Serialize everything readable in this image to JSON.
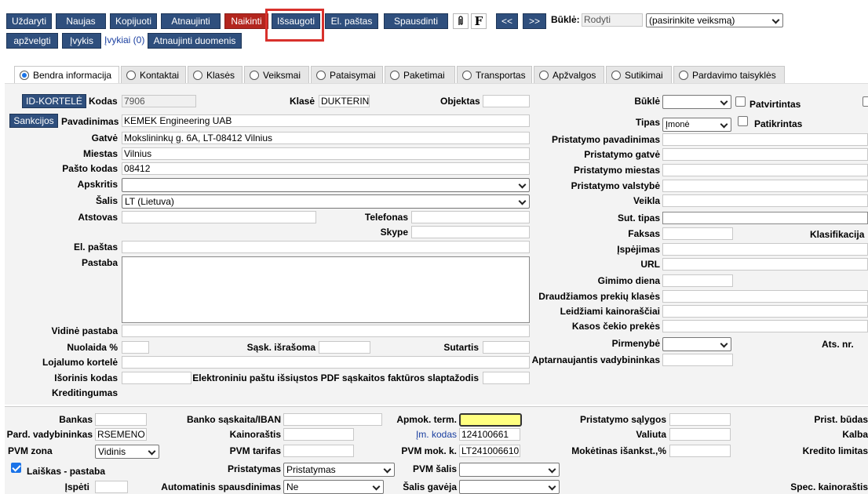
{
  "toolbar": {
    "close": "Uždaryti",
    "new": "Naujas",
    "copy": "Kopijuoti",
    "refresh": "Atnaujinti",
    "cancel": "Naikinti",
    "save": "Išsaugoti",
    "email": "El. paštas",
    "print": "Spausdinti",
    "f_icon": "F",
    "prev": "<<",
    "next": ">>",
    "status_label": "Būklė:",
    "status_value": "Rodyti",
    "action_select": "(pasirinkite veiksmą)",
    "overview": "apžvelgti",
    "events": "Įvykis",
    "events_count": "Įvykiai (0)",
    "refresh_data": "Atnaujinti duomenis"
  },
  "tabs": [
    {
      "label": "Bendra informacija",
      "active": true
    },
    {
      "label": "Kontaktai",
      "active": false
    },
    {
      "label": "Klasės",
      "active": false
    },
    {
      "label": "Veiksmai",
      "active": false
    },
    {
      "label": "Pataisymai",
      "active": false
    },
    {
      "label": "Paketimai",
      "active": false
    },
    {
      "label": "Transportas",
      "active": false
    },
    {
      "label": "Apžvalgos",
      "active": false
    },
    {
      "label": "Sutikimai",
      "active": false
    },
    {
      "label": "Pardavimo taisyklės",
      "active": false
    }
  ],
  "form": {
    "id_card_button": "ID-KORTELĖ",
    "code_label": "Kodas",
    "code_value": "7906",
    "class_label": "Klasė",
    "class_value": "DUKTERINI",
    "object_label": "Objektas",
    "state_label": "Būklė",
    "confirmed_label": "Patvirtintas",
    "sanctions_button": "Sankcijos",
    "name_label": "Pavadinimas",
    "name_value": "KEMEK Engineering UAB",
    "type_label": "Tipas",
    "type_value": "Įmonė",
    "verified_label": "Patikrintas",
    "street_label": "Gatvė",
    "street_value": "Mokslininkų g. 6A, LT-08412 Vilnius",
    "delivery_name_label": "Pristatymo pavadinimas",
    "city_label": "Miestas",
    "city_value": "Vilnius",
    "delivery_street_label": "Pristatymo gatvė",
    "postcode_label": "Pašto kodas",
    "postcode_value": "08412",
    "delivery_city_label": "Pristatymo miestas",
    "county_label": "Apskritis",
    "delivery_country_label": "Pristatymo valstybė",
    "country_label": "Šalis",
    "country_value": "LT (Lietuva)",
    "activity_label": "Veikla",
    "representative_label": "Atstovas",
    "phone_label": "Telefonas",
    "contract_type_label": "Sut. tipas",
    "skype_label": "Skype",
    "fax_label": "Faksas",
    "classification_label": "Klasifikacija",
    "email_label": "El. paštas",
    "warning_label": "Įspėjimas",
    "note_label": "Pastaba",
    "url_label": "URL",
    "birthday_label": "Gimimo diena",
    "forbidden_label": "Draudžiamos prekių klasės",
    "allowed_prices_label": "Leidžiami kainoraščiai",
    "receipt_item_label": "Kasos čekio prekės",
    "internal_note_label": "Vidinė pastaba",
    "priority_label": "Pirmenybė",
    "ats_label": "Ats. nr.",
    "discount_label": "Nuolaida %",
    "invoice_label": "Sąsk. išrašoma",
    "contract_label": "Sutartis",
    "service_manager_label": "Aptarnaujantis vadybininkas",
    "loyalty_label": "Lojalumo kortelė",
    "external_code_label": "Išorinis kodas",
    "pdf_password_label": "Elektroniniu paštu išsiųstos PDF sąskaitos faktūros slaptažodis",
    "credit_label": "Kreditingumas"
  },
  "bottom": {
    "bank_label": "Bankas",
    "iban_label": "Banko sąskaita/IBAN",
    "payment_term_label": "Apmok. term.",
    "delivery_terms_label": "Pristatymo sąlygos",
    "delivery_method_label": "Prist. būdas",
    "sales_manager_label": "Pard. vadybininkas",
    "sales_manager_value": "RSEMENO",
    "pricelist_label": "Kainoraštis",
    "company_code_label": "Įm. kodas",
    "company_code_value": "124100661",
    "currency_label": "Valiuta",
    "language_label": "Kalba",
    "vat_zone_label": "PVM zona",
    "vat_zone_value": "Vidinis",
    "vat_rate_label": "PVM tarifas",
    "vat_code_label": "PVM mok. k.",
    "vat_code_value": "LT241006610",
    "prepayment_label": "Mokėtinas išankst.,%",
    "credit_limit_label": "Kredito limitas",
    "letter_note_label": "Laiškas - pastaba",
    "delivery_label": "Pristatymas",
    "delivery_value": "Pristatymas",
    "vat_country_label": "PVM šalis",
    "warn_label": "Įspėti",
    "autoprint_label": "Automatinis spausdinimas",
    "autoprint_value": "Ne",
    "recipient_country_label": "Šalis gavėja",
    "special_pricelist_label": "Spec. kainoraštis"
  }
}
